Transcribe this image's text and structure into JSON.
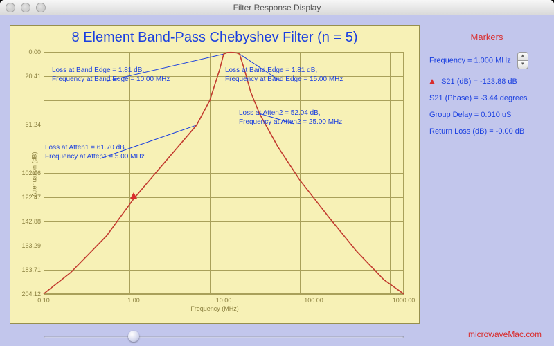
{
  "window": {
    "title": "Filter Response Display"
  },
  "chart_data": {
    "type": "line",
    "title": "8 Element Band-Pass Chebyshev Filter (n = 5)",
    "xlabel": "Frequency (MHz)",
    "ylabel": "Attenuation (dB)",
    "x_scale": "log",
    "xlim": [
      0.1,
      1000.0
    ],
    "ylim": [
      204.12,
      0.0
    ],
    "y_ticks": [
      0.0,
      20.41,
      40.82,
      61.24,
      81.65,
      102.06,
      122.47,
      142.88,
      163.29,
      183.71,
      204.12
    ],
    "y_tick_labels": [
      "0.00",
      "20.41",
      "",
      "61.24",
      "",
      "102.06",
      "122.47",
      "142.88",
      "163.29",
      "183.71",
      "204.12"
    ],
    "x_ticks": [
      0.1,
      1.0,
      10.0,
      100.0,
      1000.0
    ],
    "series": [
      {
        "name": "S21",
        "x": [
          0.1,
          0.2,
          0.5,
          1.0,
          2.0,
          5.0,
          7.0,
          9.0,
          10.0,
          11.0,
          12.0,
          13.0,
          14.0,
          15.0,
          17.0,
          20.0,
          25.0,
          40.0,
          70.0,
          150.0,
          300.0,
          600.0,
          1000.0
        ],
        "values": [
          204.0,
          186.0,
          155.0,
          123.88,
          97.0,
          61.7,
          41.0,
          15.0,
          1.81,
          0.5,
          0.4,
          0.5,
          0.9,
          1.81,
          15.0,
          34.0,
          52.04,
          80.0,
          108.0,
          140.0,
          168.0,
          192.0,
          204.0
        ]
      }
    ],
    "annotations": [
      {
        "text_lines": [
          "Loss at Band Edge = 1.81 dB,",
          "Frequency at Band Edge = 10.00 MHz"
        ],
        "points_to": {
          "freq_mhz": 10.0,
          "loss_db": 1.81
        }
      },
      {
        "text_lines": [
          "Loss at Band Edge = 1.81 dB,",
          "Frequency at Band Edge = 15.00 MHz"
        ],
        "points_to": {
          "freq_mhz": 15.0,
          "loss_db": 1.81
        }
      },
      {
        "text_lines": [
          "Loss at Atten2 = 52.04 dB,",
          "Frequency at Atten2 = 25.00 MHz"
        ],
        "points_to": {
          "freq_mhz": 25.0,
          "loss_db": 52.04
        }
      },
      {
        "text_lines": [
          "Loss at Atten1 = 61.70 dB,",
          "Frequency at Atten1 = 5.00 MHz"
        ],
        "points_to": {
          "freq_mhz": 5.0,
          "loss_db": 61.7
        }
      }
    ],
    "marker": {
      "freq_mhz": 1.0,
      "loss_db": 123.88
    }
  },
  "markers_panel": {
    "heading": "Markers",
    "frequency_label": "Frequency = 1.000 MHz",
    "s21_db": "S21 (dB) = -123.88 dB",
    "s21_phase": "S21 (Phase) = -3.44 degrees",
    "group_delay": "Group Delay = 0.010 uS",
    "return_loss": "Return Loss (dB) = -0.00 dB"
  },
  "brand": "microwaveMac.com"
}
